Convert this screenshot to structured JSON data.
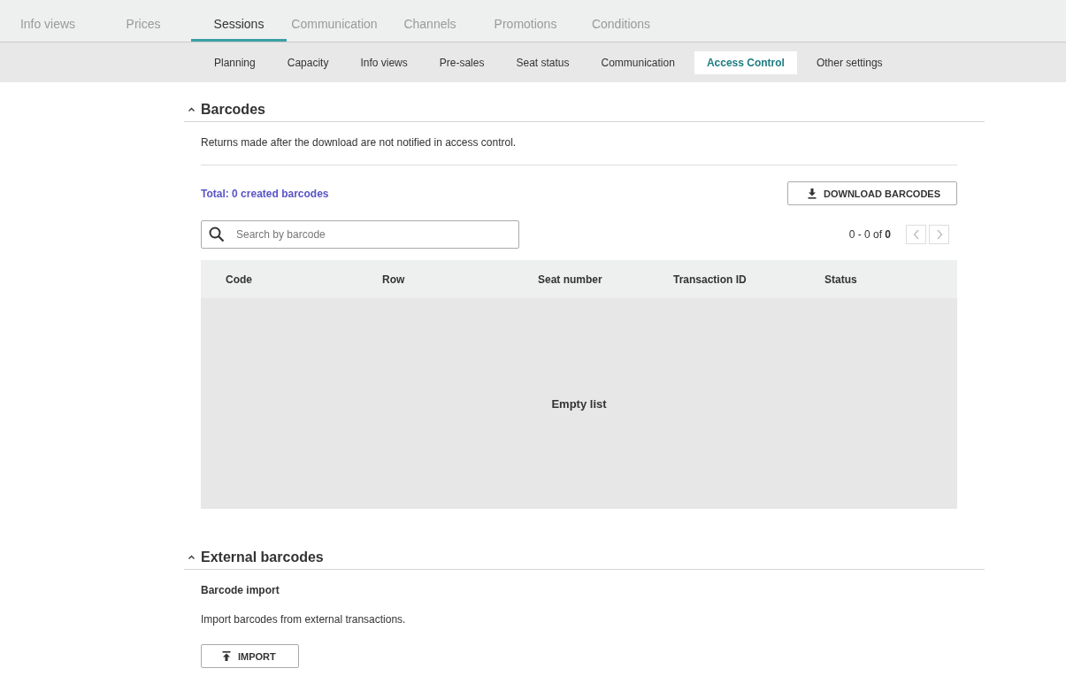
{
  "main_tabs": [
    {
      "label": "Info views",
      "selected": false
    },
    {
      "label": "Prices",
      "selected": false
    },
    {
      "label": "Sessions",
      "selected": true
    },
    {
      "label": "Communication",
      "selected": false
    },
    {
      "label": "Channels",
      "selected": false
    },
    {
      "label": "Promotions",
      "selected": false
    },
    {
      "label": "Conditions",
      "selected": false
    }
  ],
  "sub_tabs": [
    {
      "label": "Planning",
      "selected": false
    },
    {
      "label": "Capacity",
      "selected": false
    },
    {
      "label": "Info views",
      "selected": false
    },
    {
      "label": "Pre-sales",
      "selected": false
    },
    {
      "label": "Seat status",
      "selected": false
    },
    {
      "label": "Communication",
      "selected": false
    },
    {
      "label": "Access Control",
      "selected": true
    },
    {
      "label": "Other settings",
      "selected": false
    }
  ],
  "barcodes": {
    "title": "Barcodes",
    "expanded": true,
    "notice": "Returns made after the download are not notified in access control.",
    "total": "Total: 0 created barcodes",
    "download_button": "DOWNLOAD BARCODES",
    "search": {
      "placeholder": "Search by barcode"
    },
    "pagination": {
      "range": "0 - 0 of **0**",
      "prev_disabled": true,
      "next_disabled": true
    },
    "table": {
      "columns": [
        "Code",
        "Row",
        "Seat number",
        "Transaction ID",
        "Status"
      ],
      "empty_text": "Empty list"
    }
  },
  "external_barcodes": {
    "title": "External barcodes",
    "expanded": true,
    "subtitle": "Barcode import",
    "description": "Import barcodes from external transactions.",
    "import_button": "IMPORT"
  }
}
